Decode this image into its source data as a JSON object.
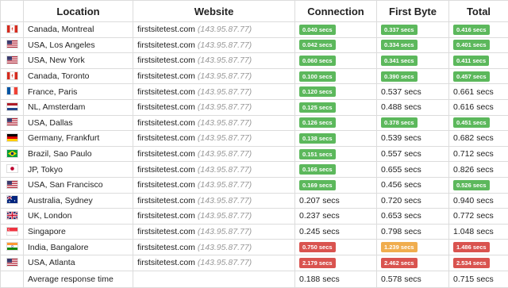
{
  "headers": {
    "location": "Location",
    "website": "Website",
    "connection": "Connection",
    "first_byte": "First Byte",
    "total": "Total"
  },
  "rows": [
    {
      "flag": "ca",
      "location": "Canada, Montreal",
      "site": "firstsitetest.com",
      "ip": "(143.95.87.77)",
      "connection": {
        "value": "0.040 secs",
        "badge": "green"
      },
      "first_byte": {
        "value": "0.337 secs",
        "badge": "green"
      },
      "total": {
        "value": "0.416 secs",
        "badge": "green"
      }
    },
    {
      "flag": "us",
      "location": "USA, Los Angeles",
      "site": "firstsitetest.com",
      "ip": "(143.95.87.77)",
      "connection": {
        "value": "0.042 secs",
        "badge": "green"
      },
      "first_byte": {
        "value": "0.334 secs",
        "badge": "green"
      },
      "total": {
        "value": "0.401 secs",
        "badge": "green"
      }
    },
    {
      "flag": "us",
      "location": "USA, New York",
      "site": "firstsitetest.com",
      "ip": "(143.95.87.77)",
      "connection": {
        "value": "0.060 secs",
        "badge": "green"
      },
      "first_byte": {
        "value": "0.341 secs",
        "badge": "green"
      },
      "total": {
        "value": "0.411 secs",
        "badge": "green"
      }
    },
    {
      "flag": "ca",
      "location": "Canada, Toronto",
      "site": "firstsitetest.com",
      "ip": "(143.95.87.77)",
      "connection": {
        "value": "0.100 secs",
        "badge": "green"
      },
      "first_byte": {
        "value": "0.390 secs",
        "badge": "green"
      },
      "total": {
        "value": "0.457 secs",
        "badge": "green"
      }
    },
    {
      "flag": "fr",
      "location": "France, Paris",
      "site": "firstsitetest.com",
      "ip": "(143.95.87.77)",
      "connection": {
        "value": "0.120 secs",
        "badge": "green"
      },
      "first_byte": {
        "value": "0.537 secs",
        "badge": null
      },
      "total": {
        "value": "0.661 secs",
        "badge": null
      }
    },
    {
      "flag": "nl",
      "location": "NL, Amsterdam",
      "site": "firstsitetest.com",
      "ip": "(143.95.87.77)",
      "connection": {
        "value": "0.125 secs",
        "badge": "green"
      },
      "first_byte": {
        "value": "0.488 secs",
        "badge": null
      },
      "total": {
        "value": "0.616 secs",
        "badge": null
      }
    },
    {
      "flag": "us",
      "location": "USA, Dallas",
      "site": "firstsitetest.com",
      "ip": "(143.95.87.77)",
      "connection": {
        "value": "0.126 secs",
        "badge": "green"
      },
      "first_byte": {
        "value": "0.378 secs",
        "badge": "green"
      },
      "total": {
        "value": "0.451 secs",
        "badge": "green"
      }
    },
    {
      "flag": "de",
      "location": "Germany, Frankfurt",
      "site": "firstsitetest.com",
      "ip": "(143.95.87.77)",
      "connection": {
        "value": "0.138 secs",
        "badge": "green"
      },
      "first_byte": {
        "value": "0.539 secs",
        "badge": null
      },
      "total": {
        "value": "0.682 secs",
        "badge": null
      }
    },
    {
      "flag": "br",
      "location": "Brazil, Sao Paulo",
      "site": "firstsitetest.com",
      "ip": "(143.95.87.77)",
      "connection": {
        "value": "0.151 secs",
        "badge": "green"
      },
      "first_byte": {
        "value": "0.557 secs",
        "badge": null
      },
      "total": {
        "value": "0.712 secs",
        "badge": null
      }
    },
    {
      "flag": "jp",
      "location": "JP, Tokyo",
      "site": "firstsitetest.com",
      "ip": "(143.95.87.77)",
      "connection": {
        "value": "0.166 secs",
        "badge": "green"
      },
      "first_byte": {
        "value": "0.655 secs",
        "badge": null
      },
      "total": {
        "value": "0.826 secs",
        "badge": null
      }
    },
    {
      "flag": "us",
      "location": "USA, San Francisco",
      "site": "firstsitetest.com",
      "ip": "(143.95.87.77)",
      "connection": {
        "value": "0.169 secs",
        "badge": "green"
      },
      "first_byte": {
        "value": "0.456 secs",
        "badge": null
      },
      "total": {
        "value": "0.526 secs",
        "badge": "green"
      }
    },
    {
      "flag": "au",
      "location": "Australia, Sydney",
      "site": "firstsitetest.com",
      "ip": "(143.95.87.77)",
      "connection": {
        "value": "0.207 secs",
        "badge": null
      },
      "first_byte": {
        "value": "0.720 secs",
        "badge": null
      },
      "total": {
        "value": "0.940 secs",
        "badge": null
      }
    },
    {
      "flag": "uk",
      "location": "UK, London",
      "site": "firstsitetest.com",
      "ip": "(143.95.87.77)",
      "connection": {
        "value": "0.237 secs",
        "badge": null
      },
      "first_byte": {
        "value": "0.653 secs",
        "badge": null
      },
      "total": {
        "value": "0.772 secs",
        "badge": null
      }
    },
    {
      "flag": "sg",
      "location": "Singapore",
      "site": "firstsitetest.com",
      "ip": "(143.95.87.77)",
      "connection": {
        "value": "0.245 secs",
        "badge": null
      },
      "first_byte": {
        "value": "0.798 secs",
        "badge": null
      },
      "total": {
        "value": "1.048 secs",
        "badge": null
      }
    },
    {
      "flag": "in",
      "location": "India, Bangalore",
      "site": "firstsitetest.com",
      "ip": "(143.95.87.77)",
      "connection": {
        "value": "0.750 secs",
        "badge": "red"
      },
      "first_byte": {
        "value": "1.239 secs",
        "badge": "orange"
      },
      "total": {
        "value": "1.486 secs",
        "badge": "red"
      }
    },
    {
      "flag": "us",
      "location": "USA, Atlanta",
      "site": "firstsitetest.com",
      "ip": "(143.95.87.77)",
      "connection": {
        "value": "2.179 secs",
        "badge": "red"
      },
      "first_byte": {
        "value": "2.462 secs",
        "badge": "red"
      },
      "total": {
        "value": "2.534 secs",
        "badge": "red"
      }
    }
  ],
  "average": {
    "label": "Average response time",
    "connection": "0.188 secs",
    "first_byte": "0.578 secs",
    "total": "0.715 secs"
  },
  "colors": {
    "green": "#5cb85c",
    "orange": "#f0ad4e",
    "red": "#d9534f",
    "border": "#dcdcdc"
  },
  "flag_icons": {
    "ca": "canada-flag-icon",
    "us": "usa-flag-icon",
    "fr": "france-flag-icon",
    "nl": "netherlands-flag-icon",
    "de": "germany-flag-icon",
    "br": "brazil-flag-icon",
    "jp": "japan-flag-icon",
    "au": "australia-flag-icon",
    "uk": "uk-flag-icon",
    "sg": "singapore-flag-icon",
    "in": "india-flag-icon"
  }
}
